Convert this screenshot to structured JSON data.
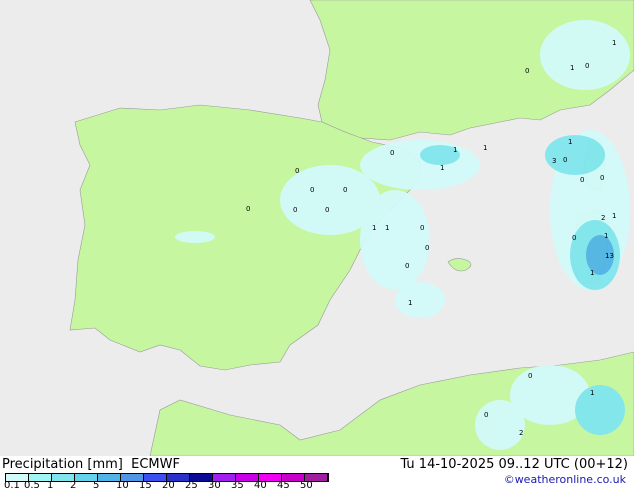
{
  "footer": {
    "title": "Precipitation [mm]",
    "model": "ECMWF",
    "datetime": "Tu 14-10-2025 09..12 UTC (00+12)",
    "credit": "©weatheronline.co.uk"
  },
  "legend": {
    "ticks": [
      "0.1",
      "0.5",
      "1",
      "2",
      "5",
      "10",
      "15",
      "20",
      "25",
      "30",
      "35",
      "40",
      "45",
      "50"
    ],
    "colors": [
      "#d2fafa",
      "#a0f5f5",
      "#80e6ee",
      "#64d2ea",
      "#50b4e6",
      "#5096e6",
      "#3c50f0",
      "#2832c8",
      "#0a0a96",
      "#a01ef0",
      "#c800e6",
      "#f000f0",
      "#c800c8",
      "#a01ea0"
    ]
  },
  "colors": {
    "sea": "#ececec",
    "land": "#c6f7a0",
    "precip_light": "#d2fafa",
    "precip_mid": "#80e6ee",
    "precip_heavy": "#50b4e6"
  },
  "map_labels": [
    "0",
    "0",
    "0",
    "0",
    "0",
    "0",
    "1",
    "1",
    "0",
    "1",
    "1",
    "1",
    "0",
    "0",
    "0",
    "1",
    "3",
    "0",
    "1",
    "0",
    "0",
    "1",
    "13",
    "1",
    "1",
    "2",
    "0",
    "0",
    "1",
    "0",
    "1",
    "0",
    "2",
    "0",
    "1"
  ]
}
